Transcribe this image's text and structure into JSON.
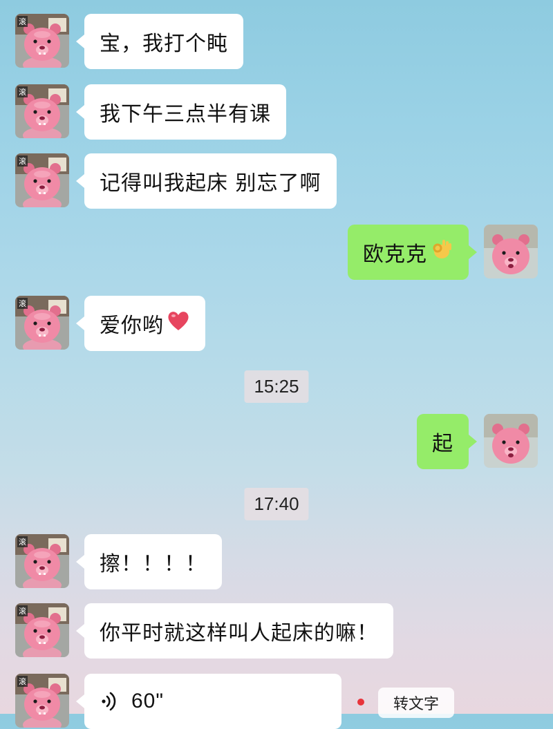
{
  "messages": [
    {
      "text": "宝，我打个盹"
    },
    {
      "text": "我下午三点半有课"
    },
    {
      "text": "记得叫我起床 别忘了啊"
    },
    {
      "text": "欧克克",
      "emoji": "ok-hand-emoji"
    },
    {
      "text": "爱你哟",
      "emoji": "red-heart-emoji"
    },
    {
      "text": "起"
    },
    {
      "text": "擦！！！！"
    },
    {
      "text": "你平时就这样叫人起床的嘛！"
    }
  ],
  "timestamps": [
    "15:25",
    "17:40"
  ],
  "voice": {
    "duration": "60\"",
    "icon": "voice-wave-icon"
  },
  "actions": {
    "to_text": "转文字"
  },
  "avatar": {
    "badge_char": "滚"
  },
  "colors": {
    "sent_bubble": "#95ec69",
    "received_bubble": "#ffffff",
    "unread_dot": "#e8343b"
  }
}
